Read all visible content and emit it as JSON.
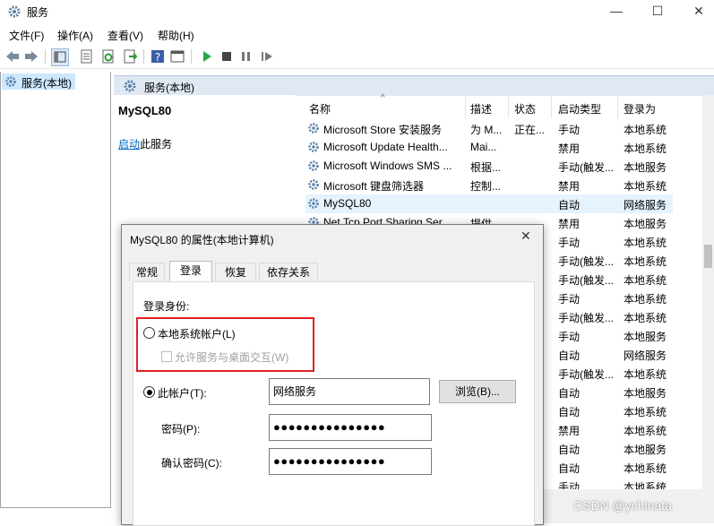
{
  "window": {
    "title": "服务",
    "min": "—",
    "max": "☐",
    "close": "✕"
  },
  "menu": [
    "文件(F)",
    "操作(A)",
    "查看(V)",
    "帮助(H)"
  ],
  "tree": {
    "root": "服务(本地)"
  },
  "pane": {
    "header": "服务(本地)",
    "service_name": "MySQL80",
    "start_link": "启动",
    "start_suffix": "此服务"
  },
  "columns": {
    "name": "名称",
    "desc": "描述",
    "status": "状态",
    "start_type": "启动类型",
    "logon": "登录为"
  },
  "services": [
    {
      "name": "Microsoft Store 安装服务",
      "desc": "为 M...",
      "status": "正在...",
      "start_type": "手动",
      "logon": "本地系统"
    },
    {
      "name": "Microsoft Update Health...",
      "desc": "Mai...",
      "status": "",
      "start_type": "禁用",
      "logon": "本地系统"
    },
    {
      "name": "Microsoft Windows SMS ...",
      "desc": "根据...",
      "status": "",
      "start_type": "手动(触发...",
      "logon": "本地服务"
    },
    {
      "name": "Microsoft 键盘筛选器",
      "desc": "控制...",
      "status": "",
      "start_type": "禁用",
      "logon": "本地系统"
    },
    {
      "name": "MySQL80",
      "desc": "",
      "status": "",
      "start_type": "自动",
      "logon": "网络服务"
    },
    {
      "name": "Net.Tcp Port Sharing Ser...",
      "desc": "提供...",
      "status": "",
      "start_type": "禁用",
      "logon": "本地服务"
    }
  ],
  "extra_rows": [
    {
      "start_type": "手动",
      "logon": "本地系统"
    },
    {
      "start_type": "手动(触发...",
      "logon": "本地系统"
    },
    {
      "start_type": "手动(触发...",
      "logon": "本地系统"
    },
    {
      "start_type": "手动",
      "logon": "本地系统"
    },
    {
      "start_type": "手动(触发...",
      "logon": "本地系统"
    },
    {
      "start_type": "手动",
      "logon": "本地服务"
    },
    {
      "start_type": "自动",
      "logon": "网络服务"
    },
    {
      "start_type": "手动(触发...",
      "logon": "本地系统"
    },
    {
      "start_type": "自动",
      "logon": "本地服务"
    },
    {
      "start_type": "自动",
      "logon": "本地系统"
    },
    {
      "start_type": "禁用",
      "logon": "本地系统"
    },
    {
      "start_type": "自动",
      "logon": "本地服务"
    },
    {
      "start_type": "自动",
      "logon": "本地系统"
    },
    {
      "start_type": "手动",
      "logon": "本地系统"
    }
  ],
  "dialog": {
    "title": "MySQL80 的属性(本地计算机)",
    "close": "✕",
    "tabs": [
      "常规",
      "登录",
      "恢复",
      "依存关系"
    ],
    "logon_as_label": "登录身份:",
    "local_system": "本地系统帐户(L)",
    "allow_desktop": "允许服务与桌面交互(W)",
    "this_account": "此帐户(T):",
    "account_value": "网络服务",
    "browse": "浏览(B)...",
    "password_label": "密码(P):",
    "password_value": "●●●●●●●●●●●●●●●",
    "confirm_label": "确认密码(C):",
    "confirm_value": "●●●●●●●●●●●●●●●"
  },
  "watermark": "CSDN @ychinata",
  "colors": {
    "highlight_box": "#e02020",
    "link": "#0066cc",
    "selection": "#cce8ff"
  }
}
